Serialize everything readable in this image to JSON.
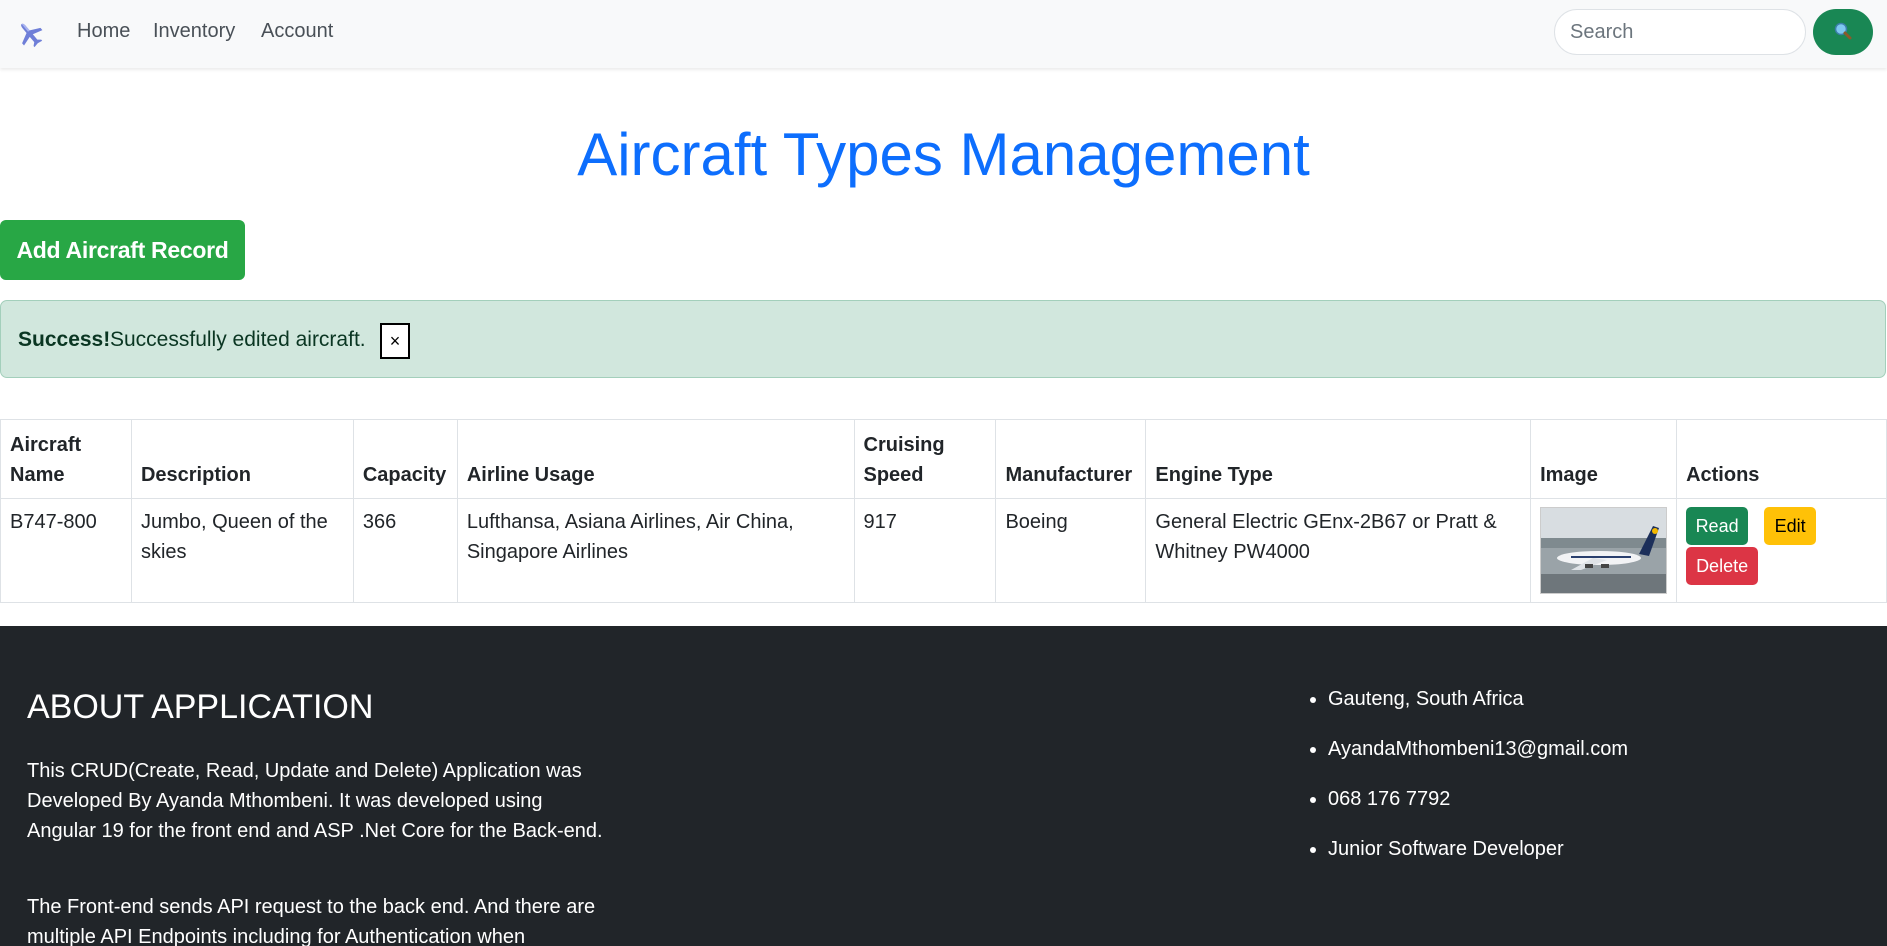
{
  "nav": {
    "brand_icon": "airplane-icon",
    "links": [
      "Home",
      "Inventory",
      "Account"
    ],
    "search_placeholder": "Search",
    "search_icon": "magnifier-icon"
  },
  "header": {
    "title": "Aircraft Types Management",
    "add_button": "Add Aircraft Record"
  },
  "alert": {
    "strong": "Success!",
    "message": "Successfully edited aircraft.",
    "close": "×"
  },
  "table": {
    "headers": {
      "name": [
        "Aircraft",
        "Name"
      ],
      "description": "Description",
      "capacity": "Capacity",
      "airline_usage": "Airline Usage",
      "speed": [
        "Cruising",
        "Speed"
      ],
      "manufacturer": "Manufacturer",
      "engine": "Engine Type",
      "image": "Image",
      "actions": "Actions"
    },
    "rows": [
      {
        "name": "B747-800",
        "description": "Jumbo, Queen of the skies",
        "capacity": "366",
        "airline_usage": "Lufthansa, Asiana Airlines, Air China, Singapore Airlines",
        "speed": "917",
        "manufacturer": "Boeing",
        "engine": "General Electric GEnx-2B67 or Pratt & Whitney PW4000",
        "read": "Read",
        "edit": "Edit",
        "delete": "Delete"
      }
    ]
  },
  "footer": {
    "about_title": "ABOUT APPLICATION",
    "about_p1": "This CRUD(Create, Read, Update and Delete) Application was Developed By Ayanda Mthombeni. It was developed using Angular 19 for the front end and ASP .Net Core for the Back-end.",
    "about_p2": "The Front-end sends API request to the back end. And there are multiple API Endpoints including for Authentication when",
    "contacts": [
      "Gauteng, South Africa",
      "AyandaMthombeni13@gmail.com",
      "068 176 7792",
      "Junior Software Developer"
    ]
  },
  "colors": {
    "title": "#0d6efd",
    "add_button": "#28a745",
    "alert_bg": "#d1e7dd",
    "read": "#198754",
    "edit": "#ffc107",
    "delete": "#dc3545",
    "footer_bg": "#212529"
  }
}
